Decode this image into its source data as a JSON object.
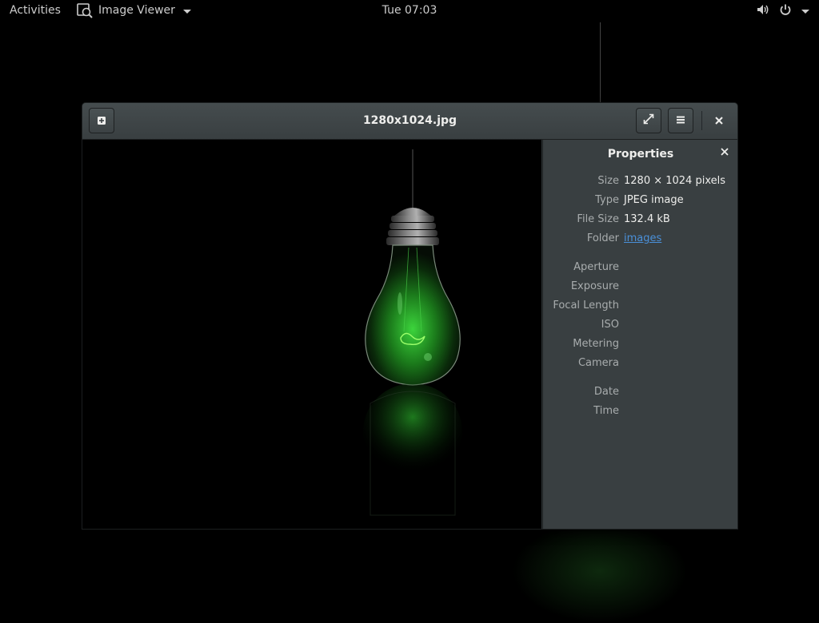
{
  "topbar": {
    "activities": "Activities",
    "app_name": "Image Viewer",
    "clock": "Tue 07:03",
    "icons": [
      "volume-icon",
      "power-icon"
    ]
  },
  "window": {
    "title": "1280x1024.jpg"
  },
  "properties": {
    "title": "Properties",
    "rows": [
      {
        "label": "Size",
        "value": "1280 × 1024 pixels"
      },
      {
        "label": "Type",
        "value": "JPEG image"
      },
      {
        "label": "File Size",
        "value": "132.4 kB"
      },
      {
        "label": "Folder",
        "value": "images"
      },
      {
        "label": "Aperture",
        "value": ""
      },
      {
        "label": "Exposure",
        "value": ""
      },
      {
        "label": "Focal Length",
        "value": ""
      },
      {
        "label": "ISO",
        "value": ""
      },
      {
        "label": "Metering",
        "value": ""
      },
      {
        "label": "Camera",
        "value": ""
      },
      {
        "label": "Date",
        "value": ""
      },
      {
        "label": "Time",
        "value": ""
      }
    ]
  },
  "colors": {
    "topbar_bg": "#000000",
    "headerbar": "#3f4547",
    "sidebar_bg": "#393f41",
    "link": "#4a90d9",
    "bulb_glow": "#3cd43c"
  }
}
